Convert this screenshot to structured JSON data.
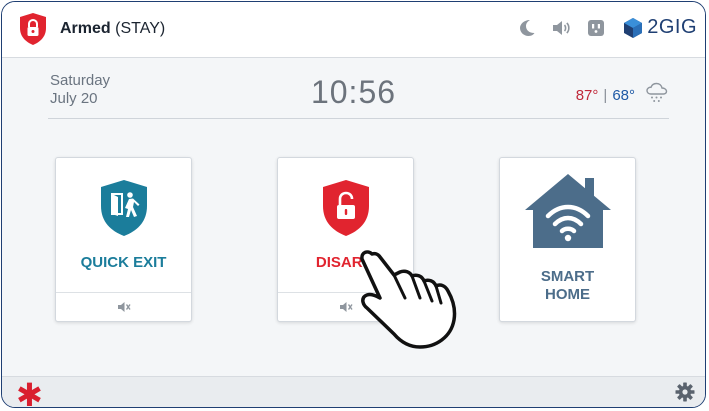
{
  "status": {
    "state": "Armed",
    "mode": "(STAY)"
  },
  "brand": {
    "name": "2GIG"
  },
  "top_icons": [
    "moon-icon",
    "speaker-icon",
    "outlet-icon"
  ],
  "date": {
    "weekday": "Saturday",
    "date": "July 20"
  },
  "clock": {
    "time": "10:56"
  },
  "weather": {
    "high": "87°",
    "separator": "|",
    "low": "68°",
    "icon": "snow-cloud-icon"
  },
  "tiles": [
    {
      "label": "QUICK EXIT",
      "icon": "exit-shield-icon",
      "footer_icon": "mute-icon"
    },
    {
      "label": "DISARM",
      "icon": "unlock-shield-icon",
      "footer_icon": "mute-icon"
    },
    {
      "label_line1": "SMART",
      "label_line2": "HOME",
      "icon": "wifi-house-icon"
    }
  ],
  "bottom": {
    "emergency_symbol": "✱",
    "settings_icon": "gear-icon"
  },
  "colors": {
    "accent_red": "#e1242f",
    "teal": "#1b7d9b",
    "house_blue": "#4c6d8a",
    "brand_navy": "#1f3f73"
  }
}
